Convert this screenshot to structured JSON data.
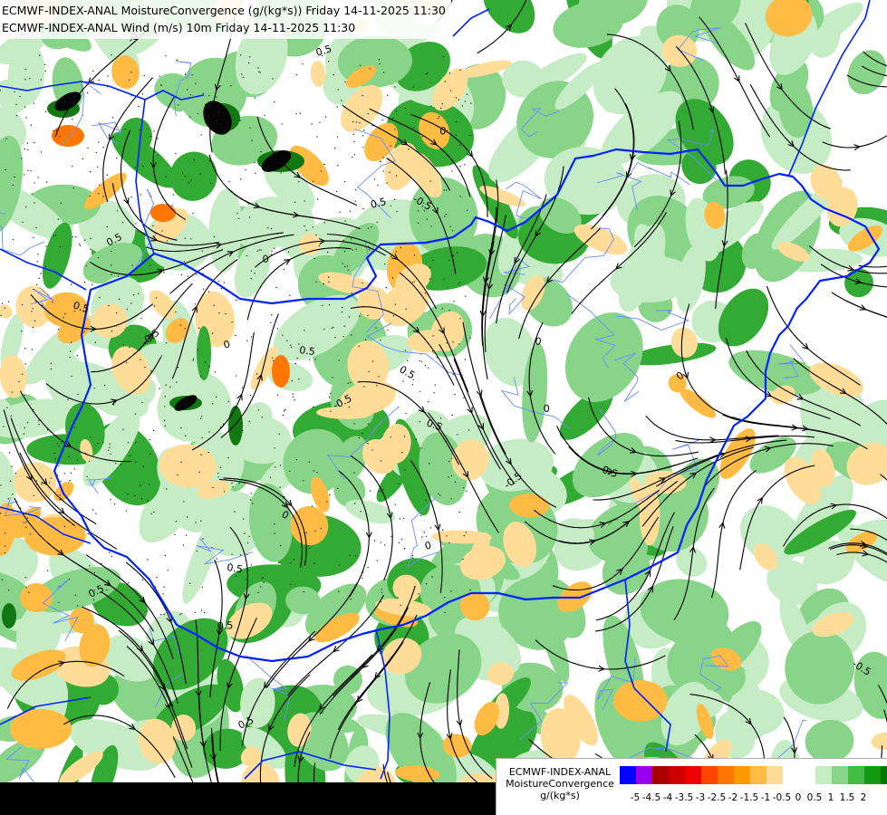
{
  "titles": {
    "line1": "ECMWF-INDEX-ANAL MoistureConvergence (g/(kg*s)) Friday 14-11-2025 11:30",
    "line2": "ECMWF-INDEX-ANAL Wind (m/s) 10m Friday 14-11-2025 11:30"
  },
  "legend": {
    "line1": "ECMWF-INDEX-ANAL",
    "line2": "MoistureConvergence",
    "line3": "g/(kg*s)",
    "colors": [
      "#0000ff",
      "#9900ee",
      "#aa0000",
      "#cc0000",
      "#ee0000",
      "#ff4400",
      "#ff7700",
      "#ff9900",
      "#ffbb44",
      "#ffdd99",
      "#ffffff",
      "#ffffff",
      "#c6ecc6",
      "#88d488",
      "#44bb44",
      "#119911",
      "#007700"
    ],
    "ticks": [
      "-5",
      "-4.5",
      "-4",
      "-3.5",
      "-3",
      "-2.5",
      "-2",
      "-1.5",
      "-1",
      "-0.5",
      "0",
      "0.5",
      "1",
      "1.5",
      "2"
    ]
  },
  "map_labels": [
    "-0.5",
    "0.5",
    "0",
    "-0.5",
    "0.5",
    "0",
    "0.5",
    "-0.5",
    "0",
    "0.5",
    "0.5",
    "-0.5",
    "0",
    "0.5",
    "-0.5",
    "0",
    "0.5",
    "0",
    "0.5",
    "0.5",
    "-0.5",
    "0",
    "0.5",
    "0",
    "-0.5",
    "0.5"
  ],
  "palette": {
    "green_light": "#c6ecc6",
    "green_mid": "#88d488",
    "green_dark": "#33aa33",
    "green_deep": "#117711",
    "orange_light": "#ffdd99",
    "orange_mid": "#ffbb44",
    "orange_dark": "#ff7700",
    "red": "#cc2200",
    "border": "#0022ff",
    "river": "#6a8cff",
    "streamline": "#000000"
  }
}
